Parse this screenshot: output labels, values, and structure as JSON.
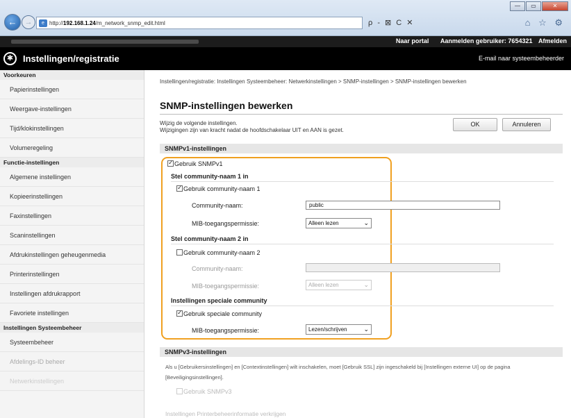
{
  "browser": {
    "url_prefix": "http://",
    "url_host": "192.168.1.24",
    "url_path": "/m_network_snmp_edit.html",
    "addr_tools": "ρ - ⊠ C ✕",
    "fav_icons": "⌂ ☆ ⚙",
    "window_buttons": {
      "minimize": "—",
      "maximize": "▭",
      "close": "✕"
    }
  },
  "header": {
    "portal_link": "Naar portal",
    "login_label": "Aanmelden gebruiker: 7654321",
    "logout_link": "Afmelden",
    "app_title": "Instellingen/registratie",
    "mail_link": "E-mail naar systeembeheerder"
  },
  "sidebar": {
    "sections": [
      {
        "title": "Voorkeuren",
        "items": [
          "Papierinstellingen",
          "Weergave-instellingen",
          "Tijd/klokinstellingen",
          "Volumeregeling"
        ]
      },
      {
        "title": "Functie-instellingen",
        "items": [
          "Algemene instellingen",
          "Kopieerinstellingen",
          "Faxinstellingen",
          "Scaninstellingen",
          "Afdrukinstellingen geheugenmedia",
          "Printerinstellingen",
          "Instellingen afdrukrapport",
          "Favoriete instellingen"
        ]
      },
      {
        "title": "Instellingen Systeembeheer",
        "items": [
          "Systeembeheer",
          "Afdelings-ID beheer",
          "Netwerkinstellingen"
        ]
      }
    ]
  },
  "main": {
    "breadcrumb": "Instellingen/registratie: Instellingen Systeembeheer: Netwerkinstellingen > SNMP-instellingen > SNMP-instellingen bewerken",
    "title": "SNMP-instellingen bewerken",
    "instructions_1": "Wijzig de volgende instellingen.",
    "instructions_2": "Wijzigingen zijn van kracht nadat de hoofdschakelaar UIT en AAN is gezet.",
    "ok_button": "OK",
    "cancel_button": "Annuleren",
    "snmpv1": {
      "header": "SNMPv1-instellingen",
      "use_snmpv1": "Gebruik SNMPv1",
      "community1_head": "Stel community-naam 1 in",
      "use_community1": "Gebruik community-naam 1",
      "community_name_label": "Community-naam:",
      "community1_value": "public",
      "mib_label": "MIB-toegangspermissie:",
      "mib1_value": "Alleen lezen",
      "community2_head": "Stel community-naam 2 in",
      "use_community2": "Gebruik community-naam 2",
      "community2_value": "",
      "mib2_value": "Alleen lezen",
      "special_head": "Instellingen speciale community",
      "use_special": "Gebruik speciale community",
      "mib_special_value": "Lezen/schrijven"
    },
    "snmpv3": {
      "header": "SNMPv3-instellingen",
      "note": "Als u [Gebruikersinstellingen] en [Contextinstellingen] wilt inschakelen, moet [Gebruik SSL] zijn ingeschakeld bij [Instellingen externe UI] op de pagina [Beveiligingsinstellingen].",
      "use_snmpv3": "Gebruik SNMPv3",
      "faded_footer": "Instellingen Printerbeheerinformatie verkrijgen"
    }
  }
}
